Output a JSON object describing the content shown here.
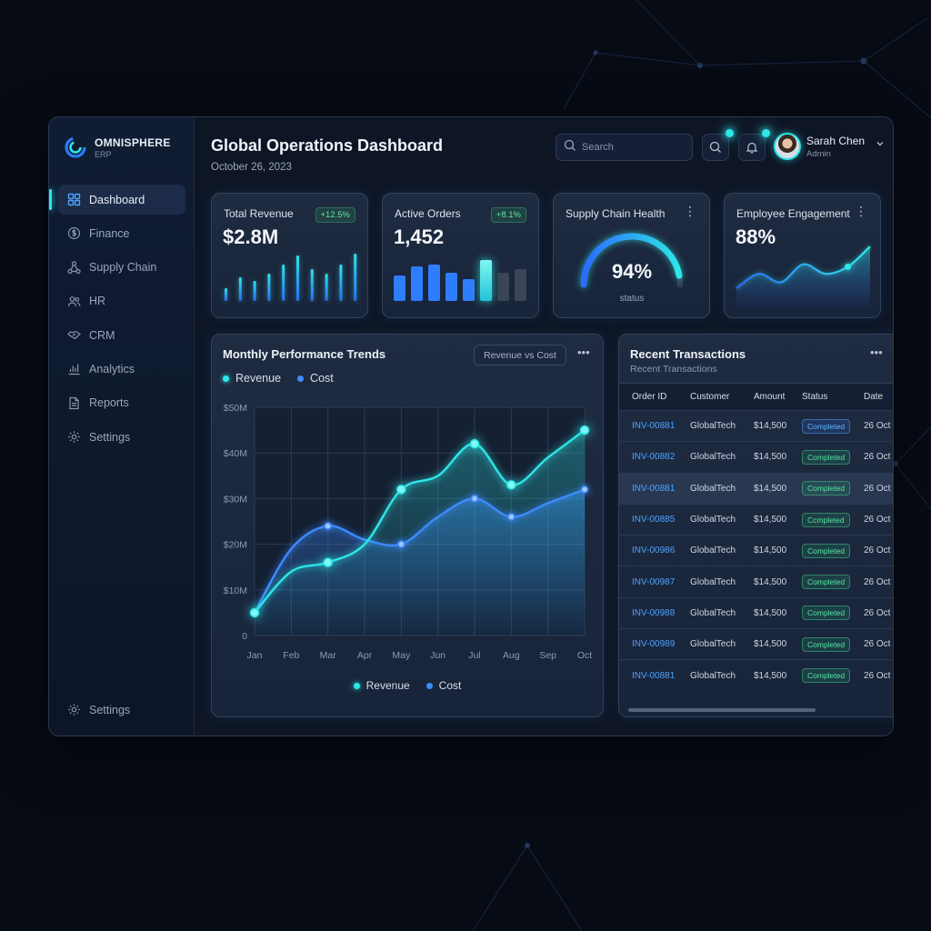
{
  "app": {
    "brand": "OMNISPHERE",
    "brand_sub": "ERP",
    "accent": "#2ee6e8",
    "accent_blue": "#3d8bff"
  },
  "sidebar": {
    "items": [
      {
        "label": "Dashboard",
        "icon": "grid-icon",
        "active": true
      },
      {
        "label": "Finance",
        "icon": "dollar-circle-icon"
      },
      {
        "label": "Supply Chain",
        "icon": "network-nodes-icon"
      },
      {
        "label": "HR",
        "icon": "users-icon"
      },
      {
        "label": "CRM",
        "icon": "handshake-icon"
      },
      {
        "label": "Analytics",
        "icon": "bar-chart-icon"
      },
      {
        "label": "Reports",
        "icon": "document-icon"
      },
      {
        "label": "Settings",
        "icon": "gear-icon"
      }
    ],
    "bottom": {
      "label": "Settings",
      "icon": "gear-icon"
    }
  },
  "header": {
    "title": "Global Operations Dashboard",
    "date": "October 26, 2023",
    "search_placeholder": "Search",
    "user_name": "Sarah Chen",
    "user_role": "Admin"
  },
  "kpis": {
    "revenue": {
      "label": "Total Revenue",
      "value": "$2.8M",
      "change": "+12.5%",
      "bars": [
        14,
        26,
        22,
        30,
        40,
        50,
        35,
        30,
        40,
        52
      ]
    },
    "orders": {
      "label": "Active Orders",
      "value": "1,452",
      "change": "+8.1%",
      "bars": [
        28,
        38,
        40,
        31,
        24,
        45,
        31,
        35
      ]
    },
    "supply": {
      "label": "Supply Chain Health",
      "value": "94%",
      "sublabel": "status",
      "level": 0.94
    },
    "engagement": {
      "label": "Employee Engagement",
      "value": "88%",
      "trend": [
        10,
        22,
        15,
        30,
        22,
        28,
        45
      ]
    }
  },
  "trend": {
    "title": "Monthly Performance Trends",
    "toggle_label": "Revenue vs Cost",
    "legend": [
      "Revenue",
      "Cost"
    ]
  },
  "chart_data": {
    "type": "line",
    "x": [
      "Jan",
      "Feb",
      "Mar",
      "Apr",
      "May",
      "Jun",
      "Jul",
      "Aug",
      "Sep",
      "Oct"
    ],
    "y_ticks": [
      "0",
      "$10M",
      "$20M",
      "$30M",
      "$40M",
      "$50M"
    ],
    "ylim": [
      0,
      50
    ],
    "series": [
      {
        "name": "Revenue",
        "color": "#2ee6e8",
        "values": [
          5,
          14,
          16,
          20,
          32,
          35,
          42,
          33,
          39,
          45
        ]
      },
      {
        "name": "Cost",
        "color": "#3d8bff",
        "values": [
          5,
          19,
          24,
          21,
          20,
          26,
          30,
          26,
          29,
          32
        ]
      }
    ],
    "markers": [
      [
        0,
        2,
        4,
        6,
        7,
        9
      ],
      [
        2,
        4,
        6,
        7,
        9
      ]
    ],
    "grid": true,
    "legend_placement": "top-left and bottom-center"
  },
  "transactions": {
    "title": "Recent Transactions",
    "subtitle": "Recent Transactions",
    "headers": [
      "Order ID",
      "Customer",
      "Amount",
      "Status",
      "Date"
    ],
    "rows": [
      {
        "id": "INV-00881",
        "customer": "GlobalTech",
        "amount": "$14,500",
        "status": "Completed",
        "date": "26 Oct",
        "status_style": "blue"
      },
      {
        "id": "INV-00882",
        "customer": "GlobalTech",
        "amount": "$14,500",
        "status": "Completed",
        "date": "26 Oct"
      },
      {
        "id": "INV-00881",
        "customer": "GlobalTech",
        "amount": "$14,500",
        "status": "Completed",
        "date": "26 Oct",
        "highlighted": true
      },
      {
        "id": "INV-00885",
        "customer": "GlobalTech",
        "amount": "$14,500",
        "status": "Ccmpleted",
        "date": "26 Oct"
      },
      {
        "id": "INV-00986",
        "customer": "GlobalTech",
        "amount": "$14,500",
        "status": "Completed",
        "date": "26 Oct"
      },
      {
        "id": "INV-00987",
        "customer": "GlobalTech",
        "amount": "$14,500",
        "status": "Completed",
        "date": "26 Oct"
      },
      {
        "id": "INV-00988",
        "customer": "GlobalTech",
        "amount": "$14,500",
        "status": "Completed",
        "date": "26 Oct"
      },
      {
        "id": "INV-00989",
        "customer": "GlobalTech",
        "amount": "$14,500",
        "status": "Completed",
        "date": "26 Oct"
      },
      {
        "id": "INV-00881",
        "customer": "GlobalTech",
        "amount": "$14,500",
        "status": "Completed",
        "date": "26 Oct"
      }
    ]
  }
}
